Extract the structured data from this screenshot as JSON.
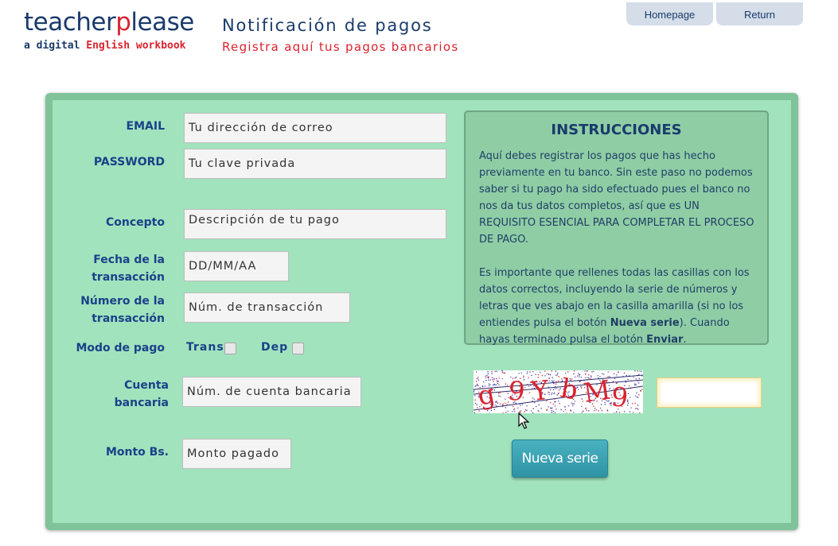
{
  "header": {
    "logo_part1": "teacher",
    "logo_accent": "p",
    "logo_part2": "lease",
    "tagline_part1": "a digital ",
    "tagline_accent": "English workbook",
    "title": "Notificación de pagos",
    "subtitle": "Registra aquí tus pagos bancarios"
  },
  "nav": {
    "home": "Homepage",
    "return": "Return"
  },
  "form": {
    "email_label": "EMAIL",
    "email_placeholder": "Tu dirección de correo",
    "password_label": "PASSWORD",
    "password_placeholder": "Tu clave privada",
    "concepto_label": "Concepto",
    "concepto_placeholder": "Descripción de tu pago",
    "fecha_label_1": "Fecha de la",
    "fecha_label_2": "transacción",
    "fecha_placeholder": "DD/MM/AA",
    "numero_label_1": "Número de la",
    "numero_label_2": "transacción",
    "numero_placeholder": "Núm. de transacción",
    "modo_label": "Modo de pago",
    "modo_trans": "Trans",
    "modo_dep": "Dep",
    "cuenta_label_1": "Cuenta",
    "cuenta_label_2": "bancaria",
    "cuenta_placeholder": "Núm. de cuenta bancaria",
    "monto_label": "Monto Bs.",
    "monto_placeholder": "Monto pagado"
  },
  "instructions": {
    "title": "INSTRUCCIONES",
    "p1": "Aquí debes registrar los pagos que has hecho previamente en tu banco. Sin este paso no podemos saber si tu pago ha sido efectuado pues el banco no nos da tus datos completos, así que es UN REQUISITO ESENCIAL PARA COMPLETAR EL PROCESO DE PAGO.",
    "p2_a": "Es importante que rellenes todas las casillas con los datos correctos, incluyendo la serie de números y letras que ves abajo en la casilla amarilla (si no los entiendes pulsa el botón ",
    "p2_b": "Nueva serie",
    "p2_c": "). Cuando hayas terminado pulsa el botón ",
    "p2_d": "Enviar",
    "p2_e": "."
  },
  "captcha": {
    "text": "g9YbM9"
  },
  "buttons": {
    "nueva_serie": "Nueva serie"
  },
  "colors": {
    "brand_blue": "#1a3b6b",
    "brand_red": "#d9232e",
    "panel_green": "#a1e3bd",
    "label_blue": "#1a4189",
    "button_teal": "#3aa0b1"
  }
}
